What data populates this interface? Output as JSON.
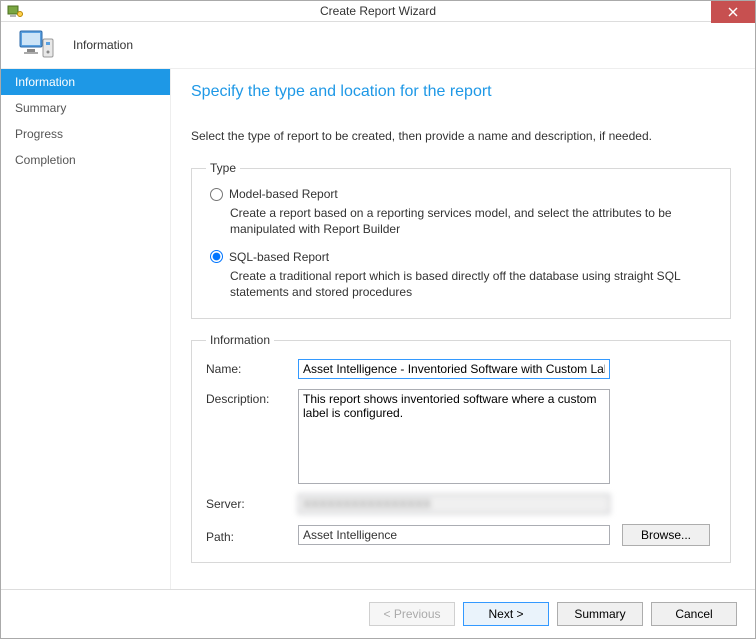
{
  "window": {
    "title": "Create Report Wizard"
  },
  "header": {
    "title": "Information"
  },
  "sidebar": {
    "items": [
      {
        "label": "Information",
        "active": true
      },
      {
        "label": "Summary",
        "active": false
      },
      {
        "label": "Progress",
        "active": false
      },
      {
        "label": "Completion",
        "active": false
      }
    ]
  },
  "page": {
    "heading": "Specify the type and location for the report",
    "instruction": "Select the type of report to be created, then provide a name and description, if needed."
  },
  "type_group": {
    "legend": "Type",
    "options": [
      {
        "label": "Model-based Report",
        "description": "Create a report based on a reporting services model, and select the attributes to be manipulated with Report Builder",
        "selected": false
      },
      {
        "label": "SQL-based Report",
        "description": "Create a traditional report which is based directly off the database using straight SQL statements and stored procedures",
        "selected": true
      }
    ]
  },
  "info_group": {
    "legend": "Information",
    "name_label": "Name:",
    "name_value": "Asset Intelligence - Inventoried Software with Custom Labels",
    "description_label": "Description:",
    "description_value": "This report shows inventoried software where a custom label is configured.",
    "server_label": "Server:",
    "server_value": "████████████████",
    "path_label": "Path:",
    "path_value": "Asset Intelligence",
    "browse_label": "Browse..."
  },
  "footer": {
    "previous": "< Previous",
    "next": "Next >",
    "summary": "Summary",
    "cancel": "Cancel"
  }
}
